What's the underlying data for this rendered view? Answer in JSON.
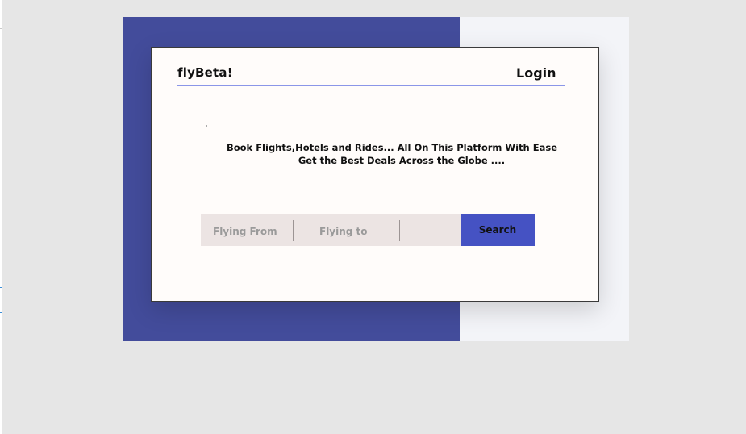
{
  "nav": {
    "logo": "flyBeta!",
    "login_label": "Login"
  },
  "hero": {
    "tagline_line1": "Book Flights,Hotels and Rides... All On This Platform With Ease",
    "tagline_line2": "Get the Best Deals Across the Globe ...."
  },
  "search": {
    "from_placeholder": "Flying From",
    "to_placeholder": "Flying to",
    "button_label": "Search"
  },
  "colors": {
    "page_background": "#e6e6e6",
    "backdrop_blue": "#434c9b",
    "backdrop_light": "#f3f4f8",
    "card_background": "#fffcfa",
    "nav_rule": "#8b96e8",
    "search_bar": "#ece4e3",
    "search_button": "#4552c3"
  }
}
